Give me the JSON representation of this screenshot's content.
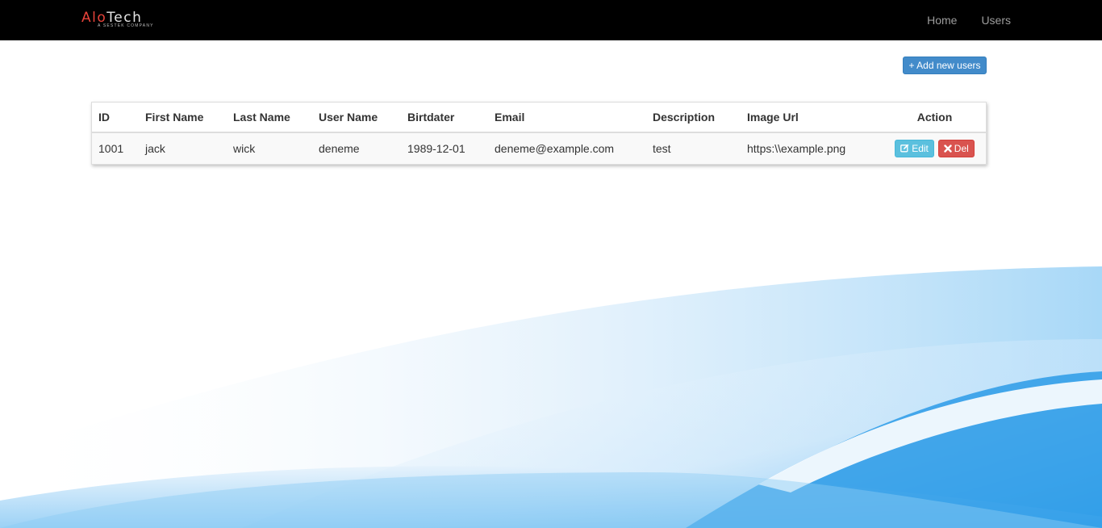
{
  "brand": {
    "name_part1": "Alo",
    "name_part2": "Tech",
    "tagline": "A SESTEK COMPANY"
  },
  "nav": {
    "items": [
      {
        "label": "Home"
      },
      {
        "label": "Users"
      }
    ]
  },
  "toolbar": {
    "add_label": "+ Add new users"
  },
  "table": {
    "columns": [
      "ID",
      "First Name",
      "Last Name",
      "User Name",
      "Birtdater",
      "Email",
      "Description",
      "Image Url",
      "Action"
    ],
    "rows": [
      {
        "id": "1001",
        "first_name": "jack",
        "last_name": "wick",
        "user_name": "deneme",
        "birthdate": "1989-12-01",
        "email": "deneme@example.com",
        "description": "test",
        "image_url": "https:\\\\example.png",
        "edit_label": "Edit",
        "del_label": "Del"
      }
    ]
  },
  "colors": {
    "navbar": "#000000",
    "brand_red": "#e8433a",
    "primary": "#428bca",
    "info": "#5bc0de",
    "danger": "#d9534f",
    "wave": "#3aa6ec"
  },
  "icons": {
    "edit": "edit-icon",
    "delete": "times-icon"
  }
}
